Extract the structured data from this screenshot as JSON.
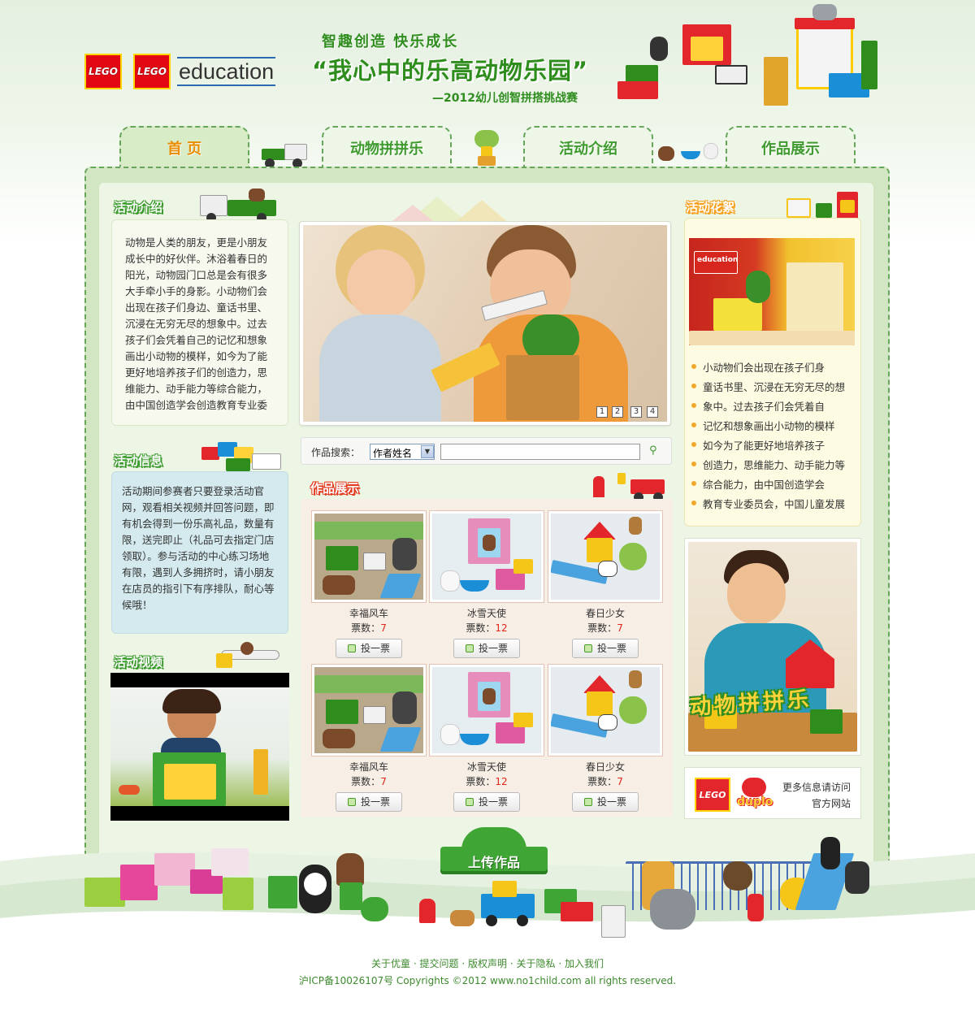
{
  "header": {
    "logo1": "LEGO",
    "logo2": "LEGO",
    "logo_word": "education",
    "slogan": "智趣创造 快乐成长",
    "title": "“我心中的乐高动物乐园”",
    "subtitle": "—2012幼儿创智拼搭挑战赛"
  },
  "tabs": [
    {
      "label": "首 页"
    },
    {
      "label": "动物拼拼乐"
    },
    {
      "label": "活动介绍"
    },
    {
      "label": "作品展示"
    }
  ],
  "left": {
    "intro_title": "活动介绍",
    "intro_text": "动物是人类的朋友，更是小朋友成长中的好伙伴。沐浴着春日的阳光，动物园门口总是会有很多大手牵小手的身影。小动物们会出现在孩子们身边、童话书里、沉浸在无穷无尽的想象中。过去孩子们会凭着自己的记忆和想象画出小动物的模样，如今为了能更好地培养孩子们的创造力，思维能力、动手能力等综合能力，由中国创造学会创造教育专业委",
    "info_title": "活动信息",
    "info_text": "活动期间参赛者只要登录活动官网，观看相关视频并回答问题，即有机会得到一份乐高礼品，数量有限，送完即止（礼品可去指定门店领取）。参与活动的中心练习场地有限，遇到人多拥挤时，请小朋友在店员的指引下有序排队，耐心等候哦！",
    "video_title": "活动视频"
  },
  "center": {
    "pager": [
      "1",
      "2",
      "3",
      "4"
    ],
    "search_label": "作品搜索：",
    "search_select": "作者姓名",
    "search_value": "",
    "gallery_title": "作品展示",
    "works": [
      {
        "name": "幸福风车",
        "votes_label": "票数：",
        "votes": "7",
        "button": "投一票"
      },
      {
        "name": "冰雪天使",
        "votes_label": "票数：",
        "votes": "12",
        "button": "投一票"
      },
      {
        "name": "春日少女",
        "votes_label": "票数：",
        "votes": "7",
        "button": "投一票"
      },
      {
        "name": "幸福风车",
        "votes_label": "票数：",
        "votes": "7",
        "button": "投一票"
      },
      {
        "name": "冰雪天使",
        "votes_label": "票数：",
        "votes": "12",
        "button": "投一票"
      },
      {
        "name": "春日少女",
        "votes_label": "票数：",
        "votes": "7",
        "button": "投一票"
      }
    ],
    "upload_label": "上传作品"
  },
  "right": {
    "highlights_title": "活动花絮",
    "store_sign": "education",
    "highlights": [
      "小动物们会出现在孩子们身",
      "童话书里、沉浸在无穷无尽的想",
      "象中。过去孩子们会凭着自",
      "记忆和想象画出小动物的模样",
      "如今为了能更好地培养孩子",
      "创造力，思维能力、动手能力等",
      "综合能力，由中国创造学会",
      "教育专业委员会，中国儿童发展"
    ],
    "promo_text": "动物拼拼乐",
    "brand_lego": "LEGO",
    "brand_duplo": "duplo",
    "more_info_1": "更多信息请访问",
    "more_info_2": "官方网站"
  },
  "footer": {
    "links": [
      "关于优童",
      "提交问题",
      "版权声明",
      "关于隐私",
      "加入我们"
    ],
    "separator": "·",
    "copyright": "沪ICP备10026107号 Copyrights ©2012 www.no1child.com all rights reserved."
  },
  "colors": {
    "brand_green": "#3e9a2e",
    "highlight_orange": "#e88d00",
    "vote_red": "#e0251b"
  }
}
